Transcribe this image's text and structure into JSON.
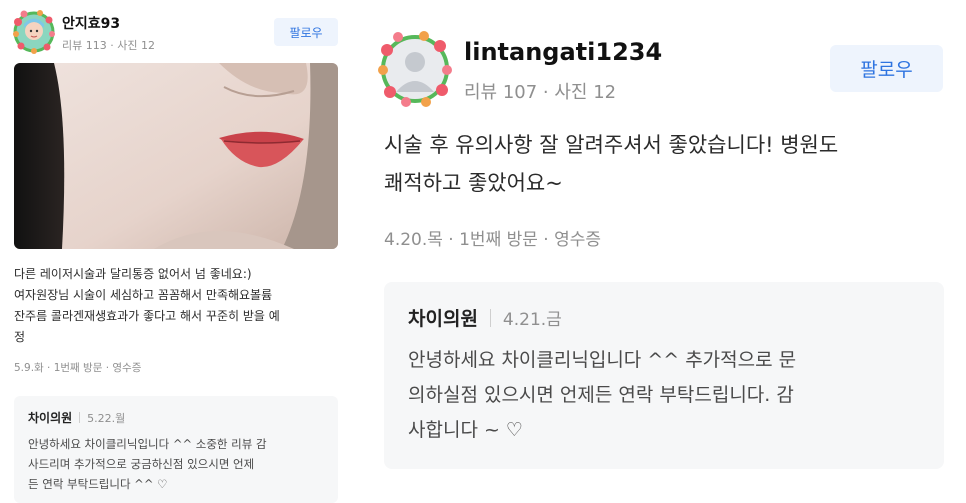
{
  "left_review": {
    "user_name": "안지효93",
    "stats": "리뷰 113 · 사진 12",
    "follow_label": "팔로우",
    "body_lines": [
      "다른 레이저시술과 달리통증 없어서 넘 좋네요:)",
      "여자원장님 시술이 세심하고 꼼꼼해서 만족해요볼륨",
      "잔주름 콜라겐재생효과가 좋다고 해서 꾸준히 받을 예",
      "정"
    ],
    "meta": "5.9.화 · 1번째 방문 · 영수증",
    "reply": {
      "name": "차이의원",
      "date": "5.22.월",
      "text_lines": [
        "안녕하세요 차이클리닉입니다 ^^ 소중한 리뷰 감",
        "사드리며 추가적으로 궁금하신점 있으시면 언제",
        "든 연락 부탁드립니다 ^^ ♡"
      ]
    }
  },
  "right_review": {
    "user_name": "lintangati1234",
    "stats": "리뷰 107 · 사진 12",
    "follow_label": "팔로우",
    "body_lines": [
      "시술 후 유의사항 잘 알려주셔서 좋았습니다! 병원도",
      "쾌적하고 좋았어요~"
    ],
    "meta": "4.20.목 · 1번째 방문 · 영수증",
    "reply": {
      "name": "차이의원",
      "date": "4.21.금",
      "text_lines": [
        "안녕하세요 차이클리닉입니다 ^^ 추가적으로 문",
        "의하실점 있으시면 언제든 연락 부탁드립니다. 감",
        "사합니다 ~ ♡"
      ]
    }
  },
  "icons": {
    "left_avatar": "avatar-with-flower-wreath-icon",
    "right_avatar": "default-profile-with-flower-wreath-icon"
  }
}
